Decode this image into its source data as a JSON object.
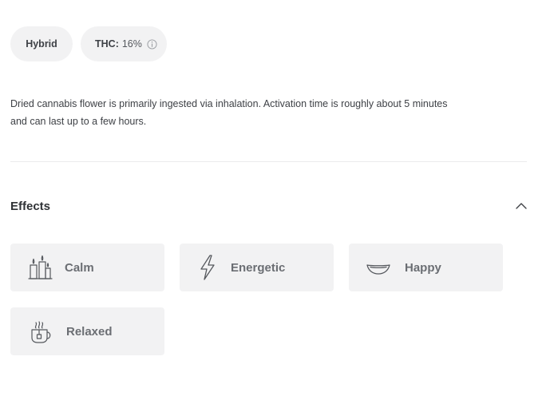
{
  "strain": {
    "type_label": "Hybrid",
    "thc_label": "THC:",
    "thc_value": "16%"
  },
  "description": "Dried cannabis flower is primarily ingested via inhalation. Activation time is roughly about 5 minutes and can last up to a few hours.",
  "effects": {
    "title": "Effects",
    "items": [
      {
        "label": "Calm",
        "icon": "candles-icon"
      },
      {
        "label": "Energetic",
        "icon": "lightning-icon"
      },
      {
        "label": "Happy",
        "icon": "smile-icon"
      },
      {
        "label": "Relaxed",
        "icon": "tea-cup-icon"
      }
    ]
  },
  "colors": {
    "pill_background": "#f2f2f3",
    "card_background": "#f2f2f3",
    "text": "#3e4146",
    "muted_text": "#6b6e73",
    "divider": "#ebebec"
  }
}
